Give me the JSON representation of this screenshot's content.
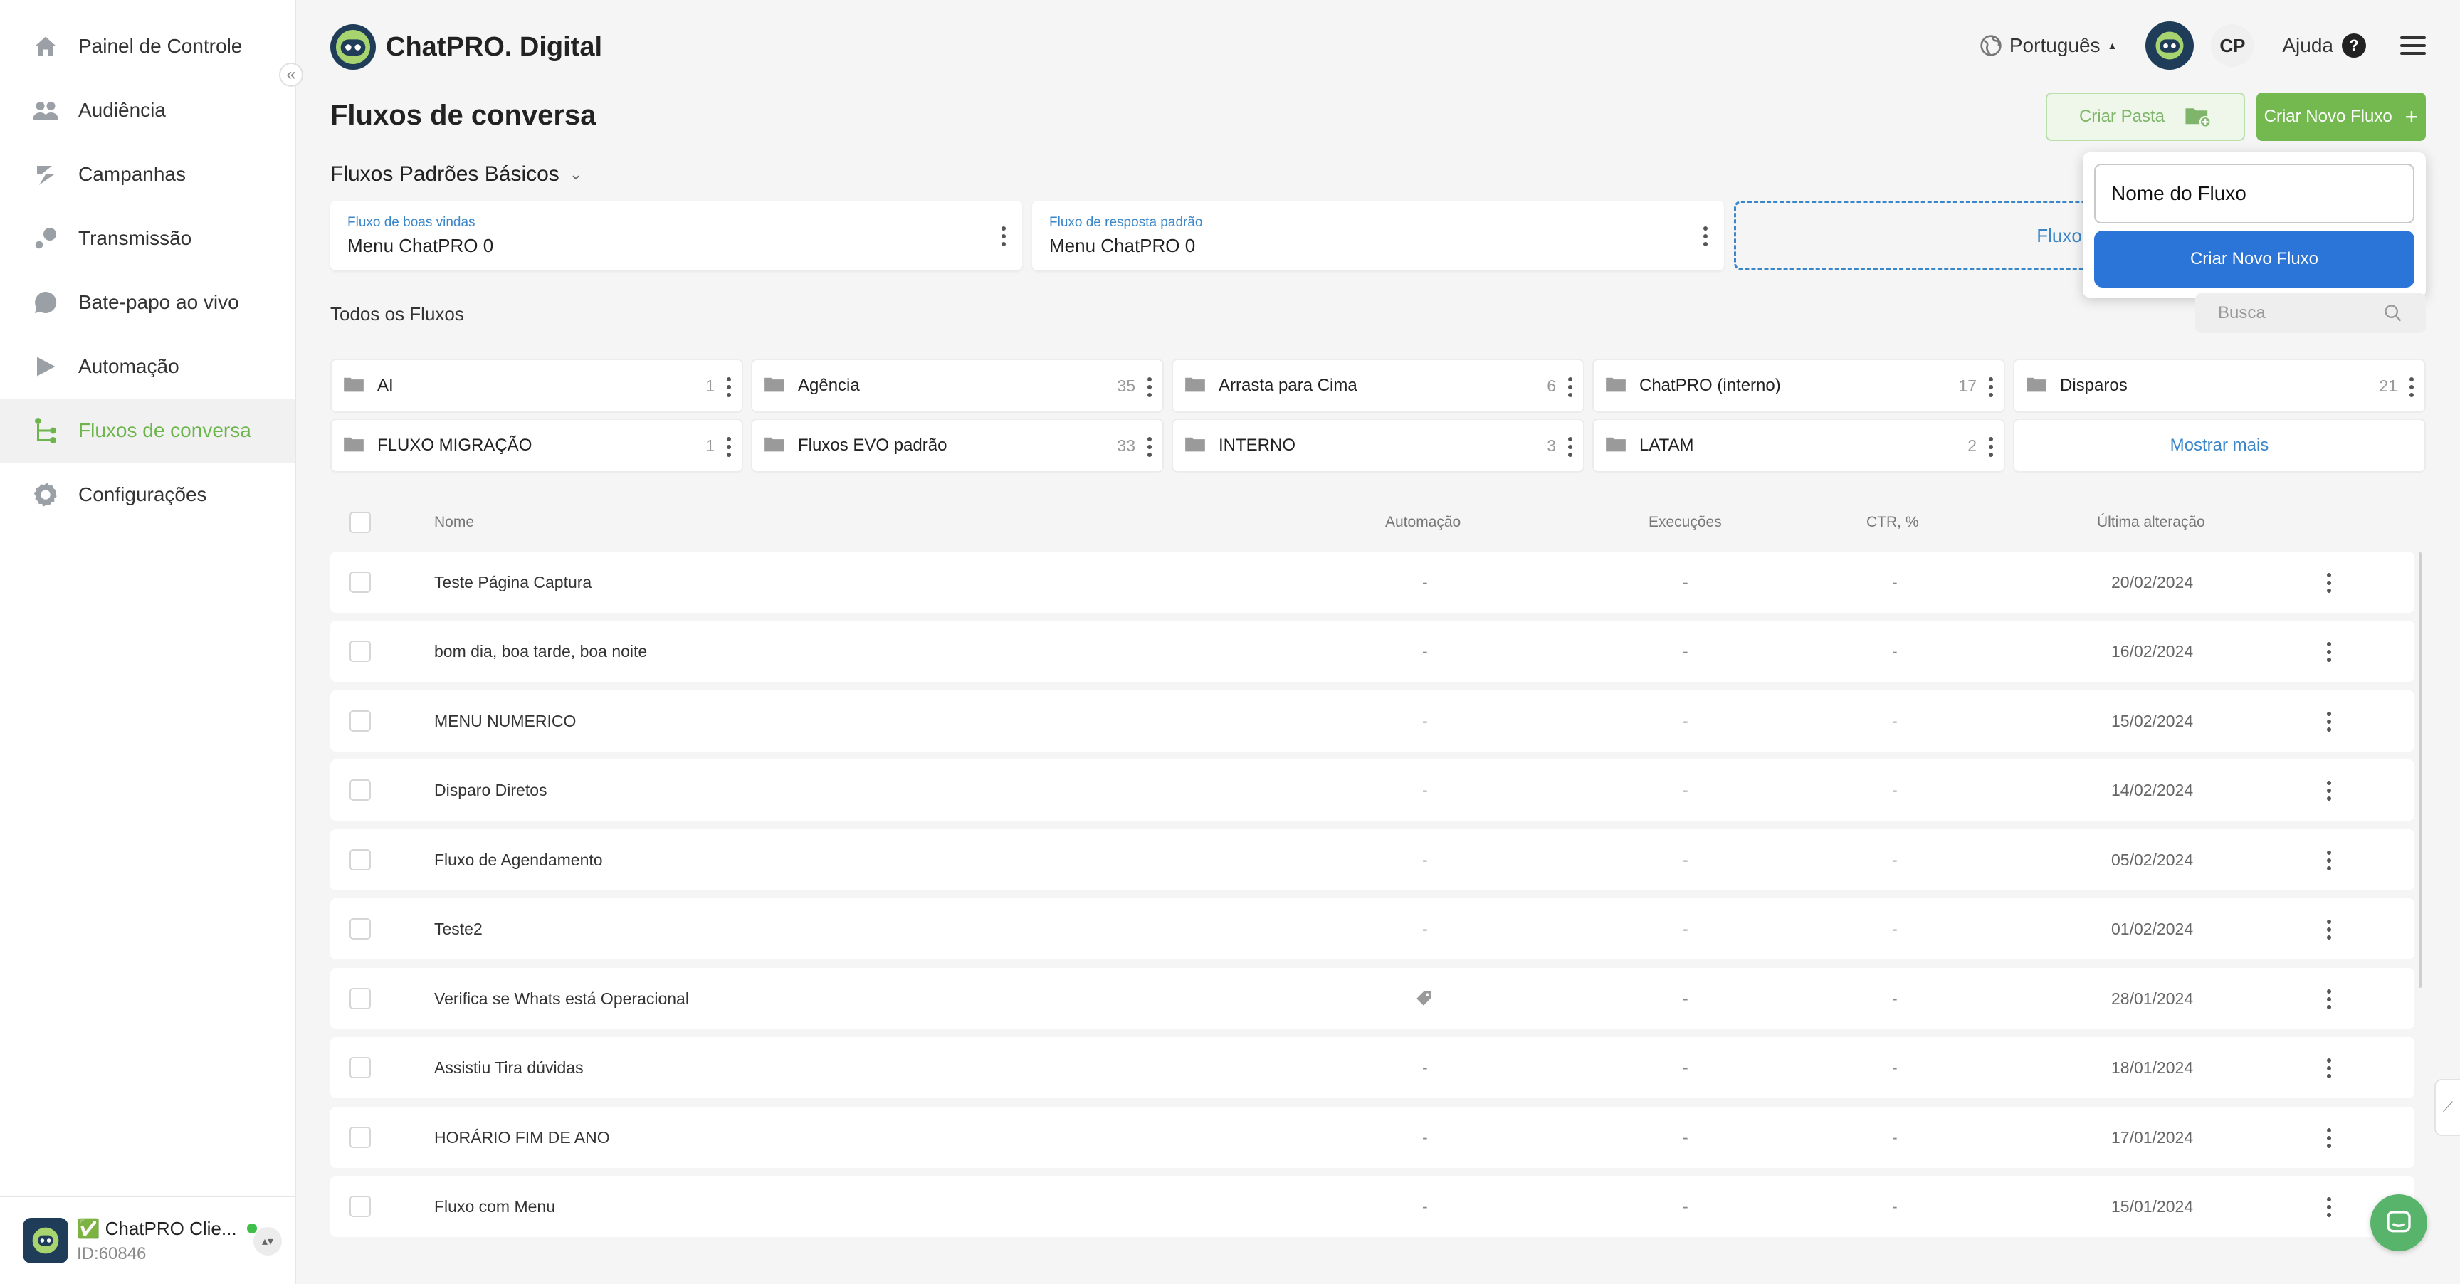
{
  "app": {
    "name": "ChatPRO. Digital"
  },
  "sidebar": {
    "items": [
      {
        "label": "Painel de Controle",
        "icon": "home-icon"
      },
      {
        "label": "Audiência",
        "icon": "users-icon"
      },
      {
        "label": "Campanhas",
        "icon": "campaign-icon"
      },
      {
        "label": "Transmissão",
        "icon": "broadcast-icon"
      },
      {
        "label": "Bate-papo ao vivo",
        "icon": "chat-bubble-icon"
      },
      {
        "label": "Automação",
        "icon": "automation-icon"
      },
      {
        "label": "Fluxos de conversa",
        "icon": "flow-icon",
        "active": true
      },
      {
        "label": "Configurações",
        "icon": "gear-icon"
      }
    ],
    "account": {
      "name": "✅ ChatPRO Clie...",
      "id": "ID:60846"
    }
  },
  "header": {
    "language": "Português",
    "initials": "CP",
    "help": "Ajuda"
  },
  "page": {
    "title": "Fluxos de conversa",
    "create_folder": "Criar Pasta",
    "create_flow": "Criar Novo Fluxo"
  },
  "popover": {
    "input_value": "Nome do Fluxo",
    "button": "Criar Novo Fluxo"
  },
  "defaults": {
    "section_title": "Fluxos Padrões Básicos",
    "welcome": {
      "label": "Fluxo de boas vindas",
      "value": "Menu ChatPRO 0"
    },
    "fallback": {
      "label": "Fluxo de resposta padrão",
      "value": "Menu ChatPRO 0"
    },
    "placeholder_card": "Fluxo padrão"
  },
  "all_flows": {
    "title": "Todos os Fluxos",
    "search_placeholder": "Busca"
  },
  "folders": [
    {
      "name": "AI",
      "count": "1"
    },
    {
      "name": "Agência",
      "count": "35"
    },
    {
      "name": "Arrasta para Cima",
      "count": "6"
    },
    {
      "name": "ChatPRO (interno)",
      "count": "17"
    },
    {
      "name": "Disparos",
      "count": "21"
    },
    {
      "name": "FLUXO MIGRAÇÃO",
      "count": "1"
    },
    {
      "name": "Fluxos EVO padrão",
      "count": "33"
    },
    {
      "name": "INTERNO",
      "count": "3"
    },
    {
      "name": "LATAM",
      "count": "2"
    }
  ],
  "show_more": "Mostrar mais",
  "table": {
    "columns": {
      "name": "Nome",
      "automation": "Automação",
      "executions": "Execuções",
      "ctr": "CTR, %",
      "updated": "Última alteração"
    },
    "rows": [
      {
        "name": "Teste Página Captura",
        "automation": "-",
        "executions": "-",
        "ctr": "-",
        "updated": "20/02/2024"
      },
      {
        "name": "bom dia, boa tarde, boa noite",
        "automation": "-",
        "executions": "-",
        "ctr": "-",
        "updated": "16/02/2024"
      },
      {
        "name": "MENU NUMERICO",
        "automation": "-",
        "executions": "-",
        "ctr": "-",
        "updated": "15/02/2024"
      },
      {
        "name": "Disparo Diretos",
        "automation": "-",
        "executions": "-",
        "ctr": "-",
        "updated": "14/02/2024"
      },
      {
        "name": "Fluxo de Agendamento",
        "automation": "-",
        "executions": "-",
        "ctr": "-",
        "updated": "05/02/2024"
      },
      {
        "name": "Teste2",
        "automation": "-",
        "executions": "-",
        "ctr": "-",
        "updated": "01/02/2024"
      },
      {
        "name": "Verifica se Whats está Operacional",
        "automation": "tag-icon",
        "executions": "-",
        "ctr": "-",
        "updated": "28/01/2024"
      },
      {
        "name": "Assistiu Tira dúvidas",
        "automation": "-",
        "executions": "-",
        "ctr": "-",
        "updated": "18/01/2024"
      },
      {
        "name": "HORÁRIO FIM DE ANO",
        "automation": "-",
        "executions": "-",
        "ctr": "-",
        "updated": "17/01/2024"
      },
      {
        "name": "Fluxo com Menu",
        "automation": "-",
        "executions": "-",
        "ctr": "-",
        "updated": "15/01/2024"
      }
    ]
  },
  "colors": {
    "accent": "#6bb54a",
    "primary_button": "#2b74d8",
    "link": "#3a86c8"
  }
}
